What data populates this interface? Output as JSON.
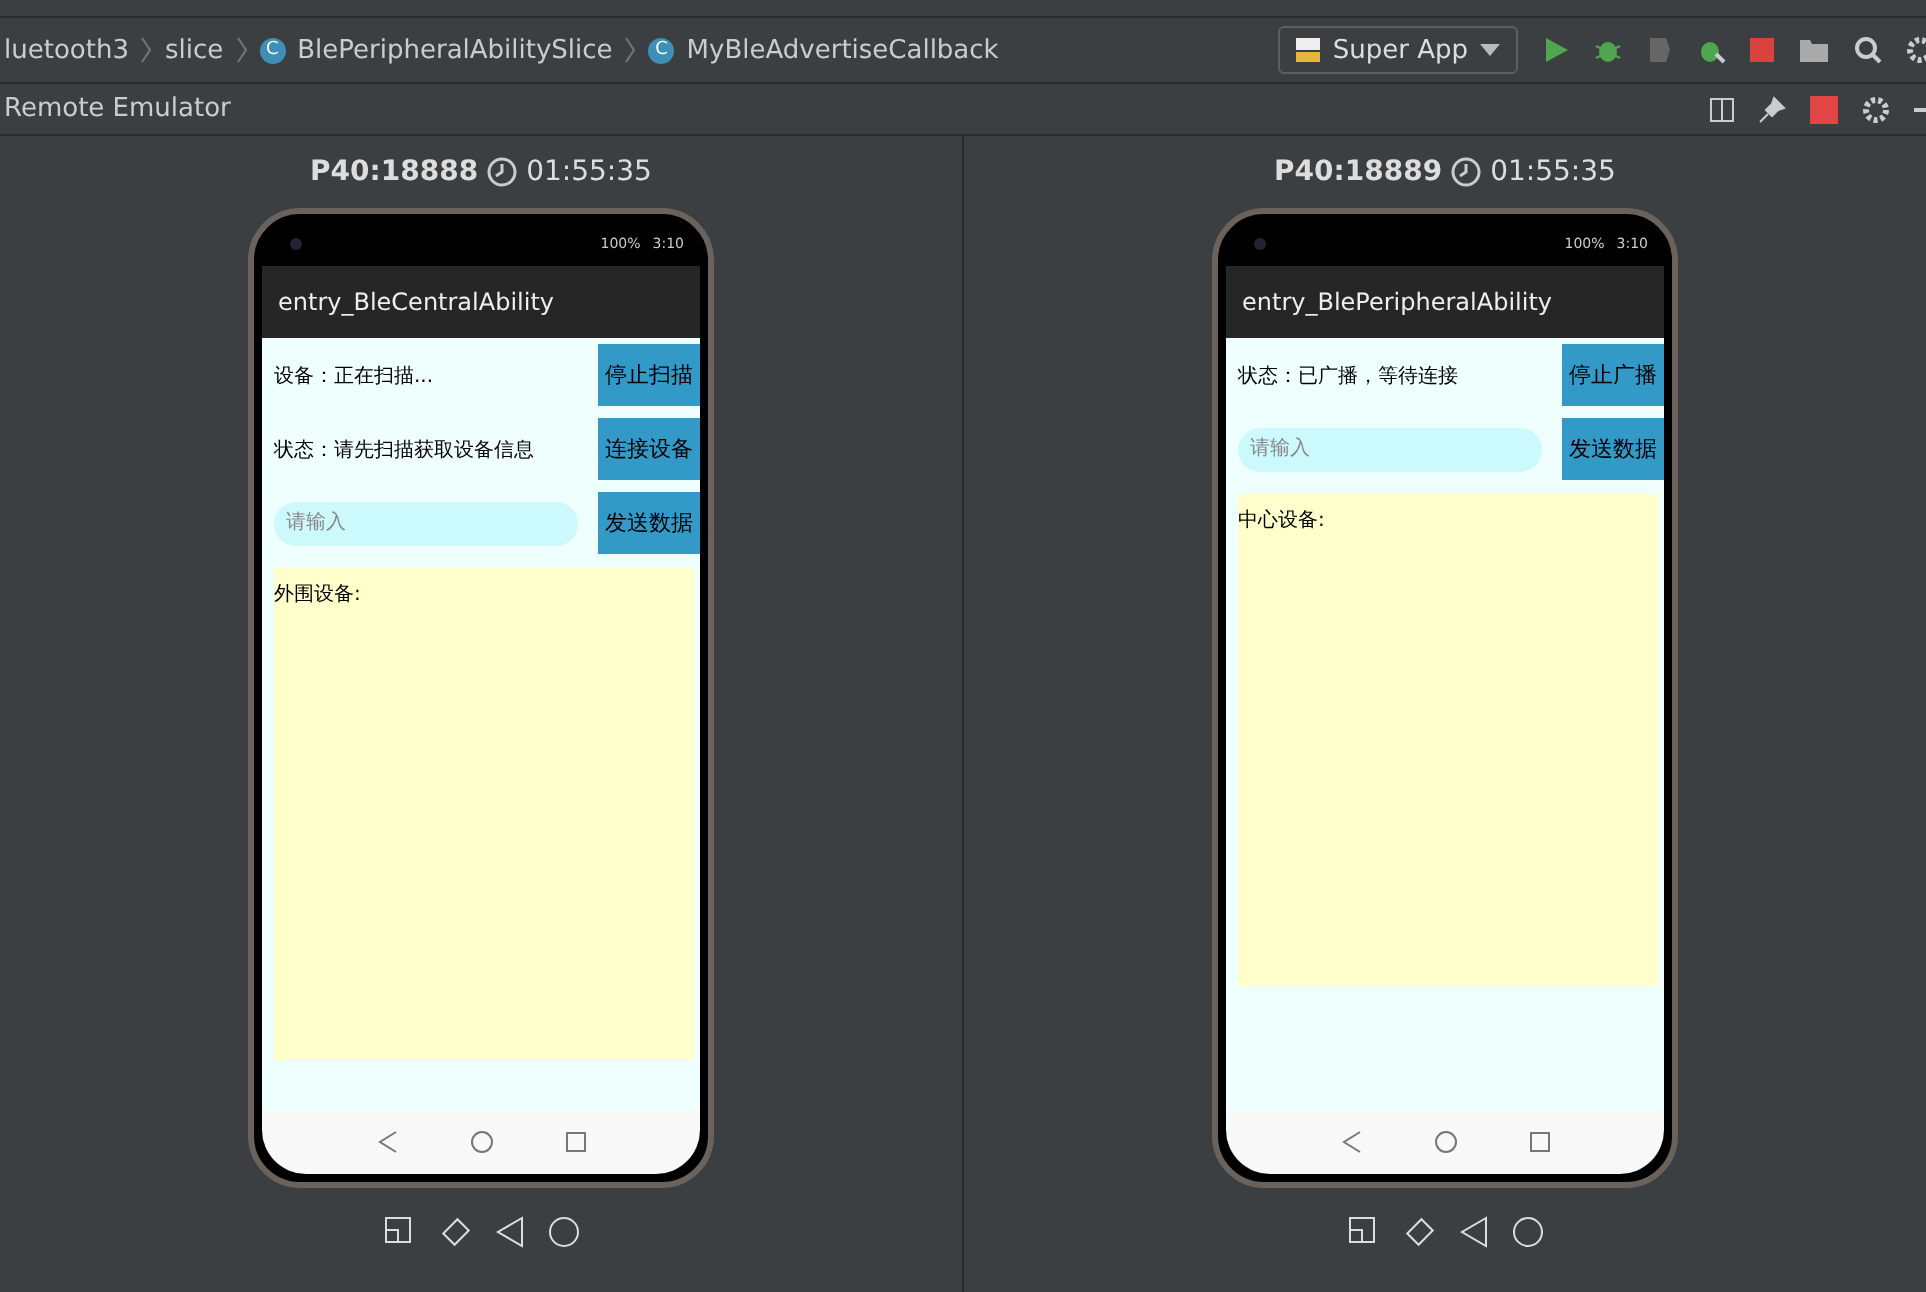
{
  "breadcrumb": [
    {
      "label": "luetooth3",
      "kind": "folder"
    },
    {
      "label": "slice",
      "kind": "folder"
    },
    {
      "label": "BlePeripheralAbilitySlice",
      "kind": "class",
      "icon": "C"
    },
    {
      "label": "MyBleAdvertiseCallback",
      "kind": "class",
      "icon": "C"
    }
  ],
  "run_config": {
    "label": "Super App"
  },
  "tool_window": {
    "title": "Remote Emulator"
  },
  "devices": [
    {
      "name": "P40:18888",
      "time": "01:55:35",
      "battery": "100%",
      "clock": "3:10",
      "app_title": "entry_BleCentralAbility",
      "rows": [
        {
          "kind": "label",
          "text": "设备：正在扫描...",
          "button": "停止扫描"
        },
        {
          "kind": "label",
          "text": "状态：请先扫描获取设备信息",
          "button": "连接设备"
        },
        {
          "kind": "input",
          "placeholder": "请输入",
          "button": "发送数据"
        }
      ],
      "panel_label": "外围设备:"
    },
    {
      "name": "P40:18889",
      "time": "01:55:35",
      "battery": "100%",
      "clock": "3:10",
      "app_title": "entry_BlePeripheralAbility",
      "rows": [
        {
          "kind": "label",
          "text": "状态：已广播，等待连接",
          "button": "停止广播"
        },
        {
          "kind": "input",
          "placeholder": "请输入",
          "button": "发送数据"
        }
      ],
      "panel_label": "中心设备:"
    }
  ]
}
